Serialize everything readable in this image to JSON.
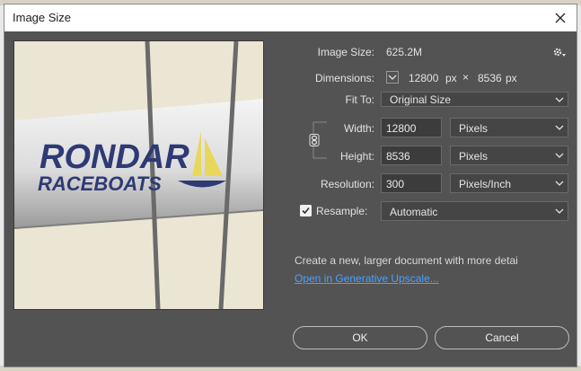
{
  "window": {
    "title": "Image Size"
  },
  "info": {
    "image_size_label": "Image Size:",
    "image_size_value": "625.2M",
    "dimensions_label": "Dimensions:",
    "dim_width": "12800",
    "dim_width_unit": "px",
    "dim_times": "×",
    "dim_height": "8536",
    "dim_height_unit": "px"
  },
  "fit_to": {
    "label": "Fit To:",
    "value": "Original Size"
  },
  "width": {
    "label": "Width:",
    "value": "12800",
    "unit": "Pixels"
  },
  "height": {
    "label": "Height:",
    "value": "8536",
    "unit": "Pixels"
  },
  "resolution": {
    "label": "Resolution:",
    "value": "300",
    "unit": "Pixels/Inch"
  },
  "resample": {
    "label": "Resample:",
    "checked": true,
    "value": "Automatic"
  },
  "upscale": {
    "description": "Create a new, larger document with more detai",
    "link": "Open in Generative Upscale..."
  },
  "preview": {
    "logo_line1": "RONDAR",
    "logo_line2": "RACEBOATS"
  },
  "buttons": {
    "ok": "OK",
    "cancel": "Cancel"
  },
  "icons": {
    "settings": "gear-icon",
    "close": "close-icon",
    "link": "chain-link-icon"
  }
}
